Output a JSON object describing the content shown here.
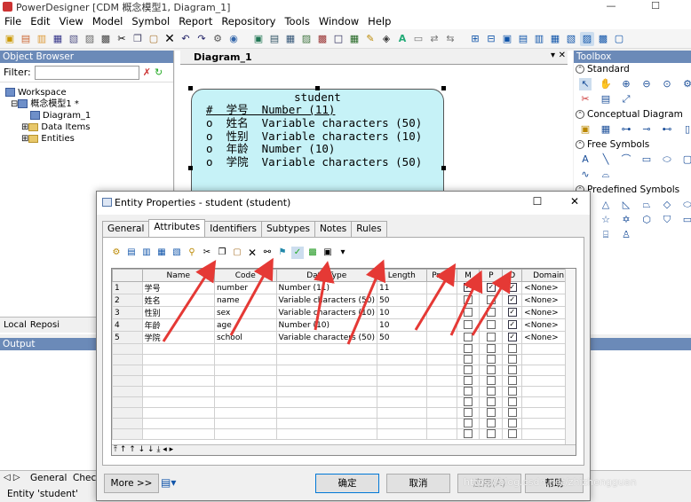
{
  "app": {
    "title": "PowerDesigner [CDM 概念模型1, Diagram_1]",
    "window_buttons": [
      "—",
      "☐",
      "✕"
    ]
  },
  "menu": [
    "File",
    "Edit",
    "View",
    "Model",
    "Symbol",
    "Report",
    "Repository",
    "Tools",
    "Window",
    "Help"
  ],
  "object_browser": {
    "title": "Object Browser",
    "filter_label": "Filter:",
    "tree": [
      {
        "label": "Workspace",
        "indent": 0
      },
      {
        "label": "概念模型1 *",
        "indent": 1
      },
      {
        "label": "Diagram_1",
        "indent": 2
      },
      {
        "label": "Data Items",
        "indent": 2
      },
      {
        "label": "Entities",
        "indent": 2
      }
    ],
    "bottom_tabs": [
      "Local",
      "Reposi"
    ]
  },
  "diagram": {
    "tab_label": "Diagram_1",
    "entity": {
      "name": "student",
      "attributes": [
        "#  学号  Number (11)",
        "o  姓名  Variable characters (50)",
        "o  性别  Variable characters (10)",
        "o  年龄  Number (10)",
        "o  学院  Variable characters (50)"
      ]
    }
  },
  "toolbox": {
    "title": "Toolbox",
    "sections": [
      "Standard",
      "Conceptual Diagram",
      "Free Symbols",
      "Predefined Symbols"
    ]
  },
  "output": {
    "title": "Output"
  },
  "bottom_tabs": [
    "General",
    "Chec"
  ],
  "status": "Entity 'student'",
  "dialog": {
    "title": "Entity Properties - student (student)",
    "tabs": [
      "General",
      "Attributes",
      "Identifiers",
      "Subtypes",
      "Notes",
      "Rules"
    ],
    "active_tab": "Attributes",
    "columns": [
      "Name",
      "Code",
      "Data Type",
      "Length",
      "Preci",
      "M",
      "P",
      "D",
      "Domain"
    ],
    "rows": [
      {
        "num": "1",
        "name": "学号",
        "code": "number",
        "type": "Number (11)",
        "length": "11",
        "m": true,
        "p": true,
        "d": true,
        "domain": "<None>"
      },
      {
        "num": "2",
        "name": "姓名",
        "code": "name",
        "type": "Variable characters (50)",
        "length": "50",
        "m": false,
        "p": false,
        "d": true,
        "domain": "<None>"
      },
      {
        "num": "3",
        "name": "性别",
        "code": "sex",
        "type": "Variable characters (10)",
        "length": "10",
        "m": false,
        "p": false,
        "d": true,
        "domain": "<None>"
      },
      {
        "num": "4",
        "name": "年龄",
        "code": "age",
        "type": "Number (10)",
        "length": "10",
        "m": false,
        "p": false,
        "d": true,
        "domain": "<None>"
      },
      {
        "num": "5",
        "name": "学院",
        "code": "school",
        "type": "Variable characters (50)",
        "length": "50",
        "m": false,
        "p": false,
        "d": true,
        "domain": "<None>"
      }
    ],
    "buttons": {
      "more": "More >>",
      "ok": "确定",
      "cancel": "取消",
      "apply": "应用(A)",
      "help": "帮助"
    }
  },
  "watermark": "https://blog.csdn.net/zhizhengguan"
}
